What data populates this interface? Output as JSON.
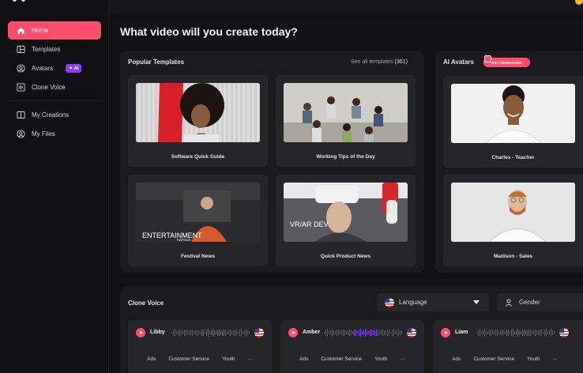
{
  "sidebar": {
    "items": [
      {
        "label": "Home",
        "icon": "home-icon"
      },
      {
        "label": "Templates",
        "icon": "templates-icon"
      },
      {
        "label": "Avatars",
        "icon": "avatar-icon",
        "badge": "AI"
      },
      {
        "label": "Clone Voice",
        "icon": "clone-voice-icon"
      },
      {
        "label": "My Creations",
        "icon": "creations-icon"
      },
      {
        "label": "My Files",
        "icon": "files-icon"
      }
    ]
  },
  "main": {
    "title": "What video will you create today?"
  },
  "templates": {
    "heading": "Popular Templates",
    "see_all": "See all templates",
    "count": "(361)",
    "cards": [
      {
        "label": "Software Quick Guide"
      },
      {
        "label": "Working Tips of the Day"
      },
      {
        "label": "Festival News",
        "overlay": "ENTERTAINMENT",
        "overlay2": "RAPINDE"
      },
      {
        "label": "Quick Product News",
        "overlay": "VR/AR DEV"
      }
    ]
  },
  "avatars": {
    "heading": "AI Avatars",
    "badge": "RECOMMENDED",
    "cards": [
      {
        "label": "Charles - Teacher"
      },
      {
        "label": "Madison - Sales"
      }
    ]
  },
  "clone_voice": {
    "heading": "Clone Voice",
    "language": "Language",
    "gender": "Gender",
    "voices": [
      {
        "name": "Libby",
        "tags": [
          "Ads",
          "Customer Service",
          "Youth",
          "···"
        ]
      },
      {
        "name": "Amber",
        "tags": [
          "Ads",
          "Customer Service",
          "Youth",
          "···"
        ]
      },
      {
        "name": "Liam",
        "tags": [
          "Ads",
          "Customer Service",
          "Youth",
          "···"
        ]
      }
    ]
  },
  "colors": {
    "accent": "#ff4d6d",
    "ai_badge": "#8b3dff",
    "background": "#121214",
    "panel": "#1b1b1e",
    "card": "#26262a"
  }
}
